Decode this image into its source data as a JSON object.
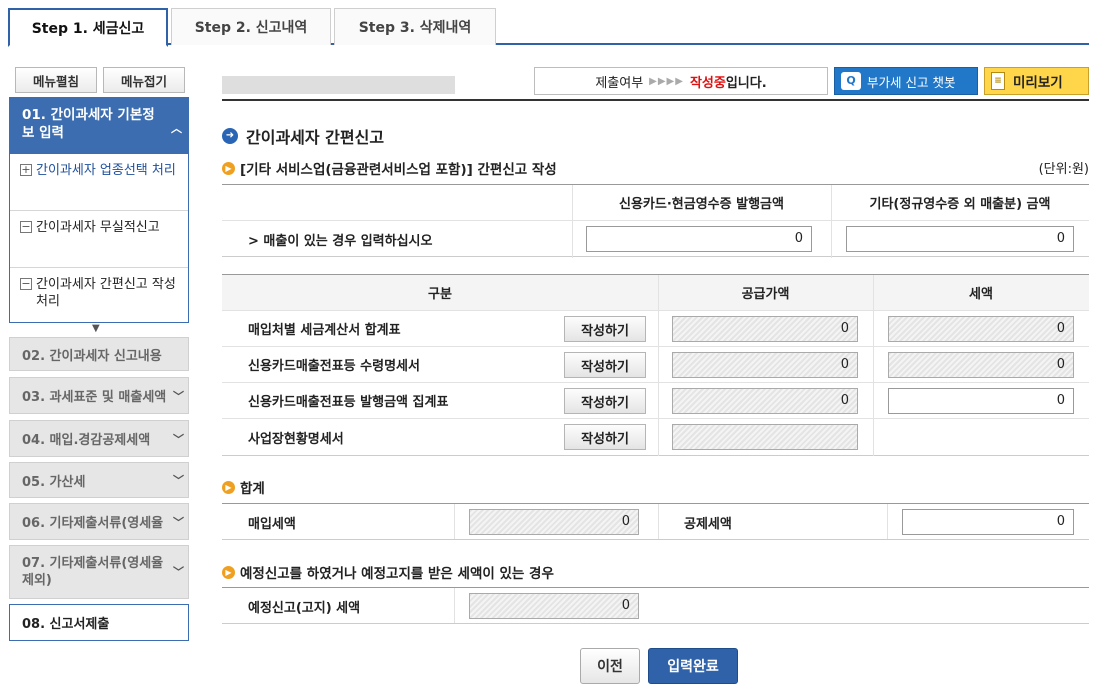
{
  "tabs": [
    {
      "label": "Step 1. 세금신고"
    },
    {
      "label": "Step 2. 신고내역"
    },
    {
      "label": "Step 3. 삭제내역"
    }
  ],
  "sidebar": {
    "expand_label": "메뉴펼침",
    "collapse_label": "메뉴접기",
    "active_menu": "01. 간이과세자 기본정보 입력",
    "sub_items": [
      {
        "label": "간이과세자 업종선택 처리",
        "icon": "plus-box-icon"
      },
      {
        "label": "간이과세자 무실적신고",
        "icon": "minus-box-icon"
      },
      {
        "label": "간이과세자 간편신고 작성 처리",
        "icon": "minus-box-icon"
      }
    ],
    "steps": [
      {
        "label": "02. 간이과세자 신고내용"
      },
      {
        "label": "03. 과세표준 및 매출세액"
      },
      {
        "label": "04. 매입.경감공제세액"
      },
      {
        "label": "05. 가산세"
      },
      {
        "label": "06. 기타제출서류(영세율"
      },
      {
        "label": "07. 기타제출서류(영세율 제외)"
      },
      {
        "label": "08. 신고서제출"
      }
    ]
  },
  "topbar": {
    "status_label": "제출여부",
    "status_red": "작성중",
    "status_suffix": "입니다.",
    "chatbot_label": "부가세 신고 챗봇",
    "preview_label": "미리보기"
  },
  "main": {
    "title": "간이과세자 간편신고",
    "section1_title": "[기타 서비스업(금융관련서비스업 포함)] 간편신고 작성",
    "unit": "(단위:원)",
    "col_card": "신용카드·현금영수증 발행금액",
    "col_other": "기타(정규영수증 외 매출분) 금액",
    "sales_row_label": "> 매출이 있는 경우 입력하십시오",
    "sales_card_value": "0",
    "sales_other_value": "0",
    "purchase_header": {
      "col1": "구분",
      "col2": "공급가액",
      "col3": "세액"
    },
    "write_label": "작성하기",
    "purchase_rows": [
      {
        "label": "매입처별 세금계산서 합계표",
        "supply": "0",
        "tax": "0"
      },
      {
        "label": "신용카드매출전표등 수령명세서",
        "supply": "0",
        "tax": "0"
      },
      {
        "label": "신용카드매출전표등 발행금액 집계표",
        "supply": "0",
        "tax": "0"
      },
      {
        "label": "사업장현황명세서",
        "supply": "",
        "tax": ""
      }
    ],
    "total_title": "합계",
    "purchase_tax_label": "매입세액",
    "purchase_tax_value": "0",
    "deduct_tax_label": "공제세액",
    "deduct_tax_value": "0",
    "prelim_title": "예정신고를 하였거나 예정고지를 받은 세액이 있는 경우",
    "prelim_label": "예정신고(고지) 세액",
    "prelim_value": "0"
  },
  "buttons": {
    "prev": "이전",
    "done": "입력완료"
  },
  "colors": {
    "primary": "#2f62a8",
    "status_red": "#dd1111",
    "preview_yellow": "#ffd54a",
    "chatbot_blue": "#2278c8"
  }
}
